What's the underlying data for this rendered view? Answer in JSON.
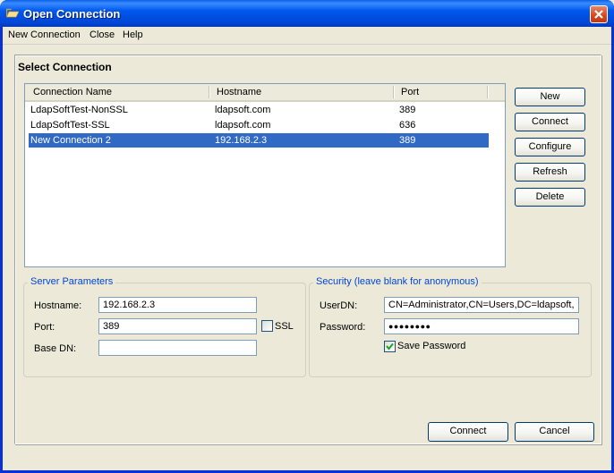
{
  "window": {
    "title": "Open Connection",
    "icon": "folder-open-icon",
    "close_icon": "close-icon"
  },
  "menu": {
    "items": [
      {
        "label": "New Connection"
      },
      {
        "label": "Close"
      },
      {
        "label": "Help"
      }
    ]
  },
  "select_connection": {
    "title": "Select Connection",
    "columns": [
      "Connection Name",
      "Hostname",
      "Port"
    ],
    "rows": [
      {
        "name": "LdapSoftTest-NonSSL",
        "hostname": "ldapsoft.com",
        "port": "389",
        "selected": false
      },
      {
        "name": "LdapSoftTest-SSL",
        "hostname": "ldapsoft.com",
        "port": "636",
        "selected": false
      },
      {
        "name": "New Connection 2",
        "hostname": "192.168.2.3",
        "port": "389",
        "selected": true
      }
    ],
    "buttons": {
      "new": "New",
      "connect": "Connect",
      "configure": "Configure",
      "refresh": "Refresh",
      "delete": "Delete"
    }
  },
  "server_parameters": {
    "title": "Server Parameters",
    "hostname_label": "Hostname:",
    "hostname_value": "192.168.2.3",
    "port_label": "Port:",
    "port_value": "389",
    "ssl_label": "SSL",
    "ssl_checked": false,
    "basedn_label": "Base DN:",
    "basedn_value": ""
  },
  "security": {
    "title": "Security (leave blank for anonymous)",
    "userdn_label": "UserDN:",
    "userdn_value": "CN=Administrator,CN=Users,DC=ldapsoft,",
    "password_label": "Password:",
    "password_mask": "●●●●●●●●",
    "save_password_label": "Save Password",
    "save_password_checked": true
  },
  "footer": {
    "connect": "Connect",
    "cancel": "Cancel"
  },
  "colors": {
    "selection": "#316ac5",
    "titlebar": "#0054e3",
    "group_title": "#0046d5"
  }
}
